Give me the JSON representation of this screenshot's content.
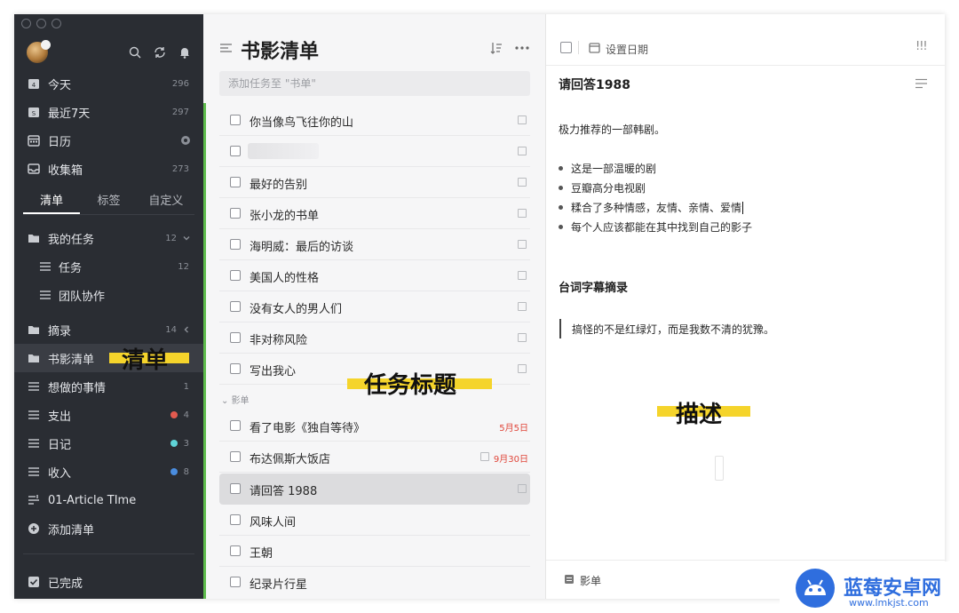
{
  "sidebar": {
    "smart_lists": [
      {
        "label": "今天",
        "count": "296"
      },
      {
        "label": "最近7天",
        "count": "297"
      },
      {
        "label": "日历",
        "count": ""
      },
      {
        "label": "收集箱",
        "count": "273"
      }
    ],
    "tabs": [
      "清单",
      "标签",
      "自定义"
    ],
    "my_tasks": {
      "label": "我的任务",
      "count": "12"
    },
    "sub_items": [
      {
        "label": "任务",
        "count": "12"
      },
      {
        "label": "团队协作",
        "count": ""
      }
    ],
    "lists": [
      {
        "label": "摘录",
        "count": "14"
      },
      {
        "label": "书影清单",
        "count": ""
      },
      {
        "label": "想做的事情",
        "count": "1"
      },
      {
        "label": "支出",
        "count": "4",
        "dot": "#e35a4f"
      },
      {
        "label": "日记",
        "count": "3",
        "dot": "#5fd4d8"
      },
      {
        "label": "收入",
        "count": "8",
        "dot": "#4a8de0"
      },
      {
        "label": "01-Article TIme",
        "count": ""
      }
    ],
    "add_list": "添加清单",
    "completed": "已完成"
  },
  "middle": {
    "title": "书影清单",
    "add_placeholder": "添加任务至 \"书单\"",
    "tasks_group1": [
      "你当像鸟飞往你的山",
      "",
      "最好的告别",
      "张小龙的书单",
      "海明威：最后的访谈",
      "美国人的性格",
      "没有女人的男人们",
      "非对称风险",
      "写出我心"
    ],
    "group2_label": "影单",
    "tasks_group2": [
      {
        "title": "看了电影《独自等待》",
        "date": "5月5日"
      },
      {
        "title": "布达佩斯大饭店",
        "date": "9月30日"
      },
      {
        "title": "请回答 1988",
        "date": ""
      },
      {
        "title": "风味人间",
        "date": ""
      },
      {
        "title": "王朝",
        "date": ""
      },
      {
        "title": "纪录片行星",
        "date": ""
      }
    ]
  },
  "detail": {
    "set_date": "设置日期",
    "priority": "!!!",
    "title": "请回答1988",
    "intro": "极力推荐的一部韩剧。",
    "bullets": [
      "这是一部温暖的剧",
      "豆瓣高分电视剧",
      "糅合了多种情感，友情、亲情、爱情",
      "每个人应该都能在其中找到自己的影子"
    ],
    "section_heading": "台词字幕摘录",
    "quote": "搞怪的不是红绿灯，而是我数不清的犹豫。",
    "footer_list": "影单"
  },
  "annotations": {
    "list_label": "清单",
    "task_title_label": "任务标题",
    "description_label": "描述"
  },
  "watermark": {
    "name": "蓝莓安卓网",
    "url": "www.lmkjst.com"
  },
  "colors": {
    "sidebar_bg": "#2a2d33",
    "accent_green": "#5ebc4c",
    "highlight_yellow": "#f5d42b",
    "date_red": "#e0463a"
  }
}
